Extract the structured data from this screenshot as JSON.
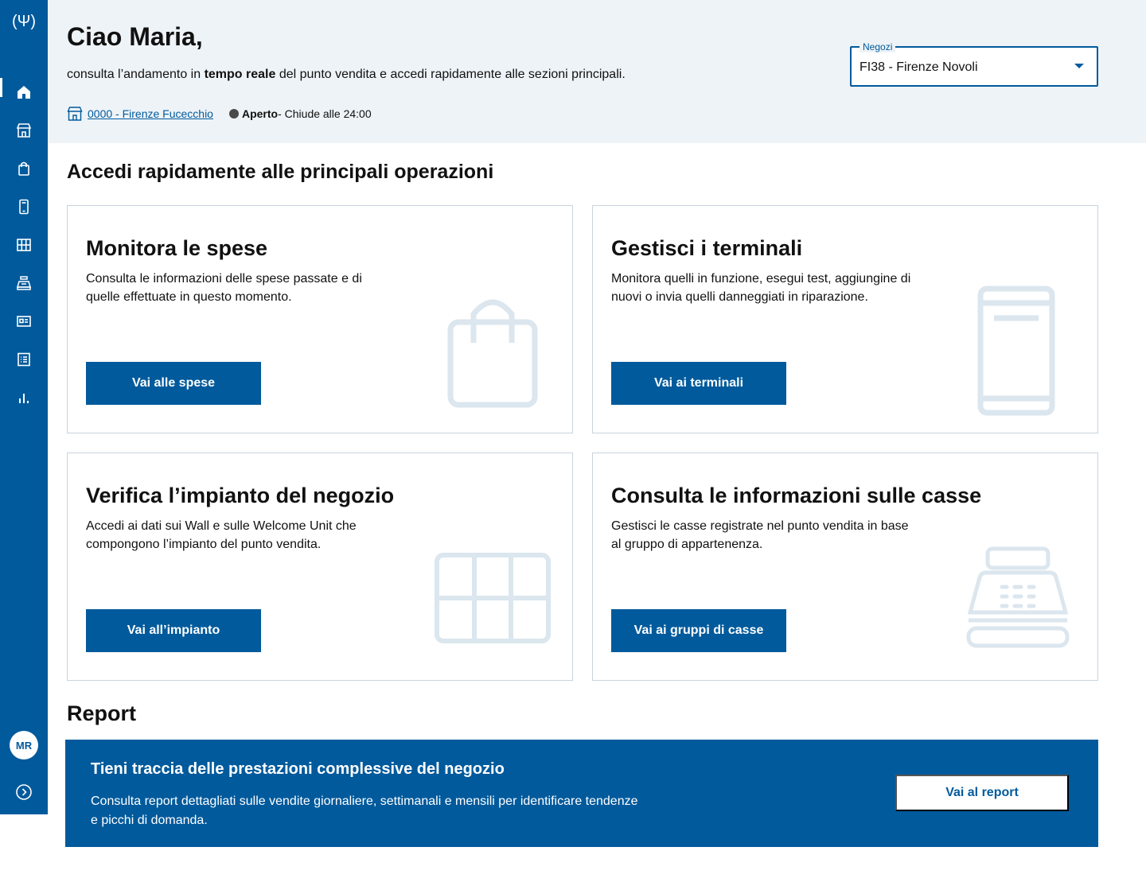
{
  "sidebar": {
    "logo": "(Ψ)",
    "items": [
      {
        "name": "home-icon",
        "label": "Home"
      },
      {
        "name": "store-icon",
        "label": "Negozio"
      },
      {
        "name": "bag-icon",
        "label": "Spese"
      },
      {
        "name": "phone-icon",
        "label": "Terminali"
      },
      {
        "name": "grid-icon",
        "label": "Impianto"
      },
      {
        "name": "cash-register-icon",
        "label": "Casse"
      },
      {
        "name": "id-card-icon",
        "label": "Anagrafica"
      },
      {
        "name": "list-icon",
        "label": "Elenco"
      },
      {
        "name": "bar-chart-icon",
        "label": "Report"
      }
    ],
    "avatar_initials": "MR"
  },
  "header": {
    "greeting": "Ciao Maria,",
    "subtitle_before": "consulta l’andamento in ",
    "subtitle_bold": "tempo reale",
    "subtitle_after": " del punto vendita e accedi rapidamente alle sezioni principali.",
    "store_link": "0000 - Firenze Fucecchio",
    "status_label": "Aperto",
    "status_detail": " - Chiude alle 24:00",
    "store_select": {
      "label": "Negozi",
      "value": "FI38 - Firenze Novoli"
    }
  },
  "quick_access": {
    "title": "Accedi rapidamente alle principali operazioni",
    "cards": [
      {
        "title": "Monitora le spese",
        "description": "Consulta le informazioni delle spese passate e di quelle effettuate in questo momento.",
        "button": "Vai alle spese"
      },
      {
        "title": "Gestisci i terminali",
        "description": "Monitora quelli in funzione, esegui test, aggiungine di nuovi o invia quelli danneggiati in riparazione.",
        "button": "Vai ai terminali"
      },
      {
        "title": "Verifica l’impianto del negozio",
        "description": "Accedi ai dati sui Wall e sulle Welcome Unit che compongono l’impianto del punto vendita.",
        "button": "Vai all’impianto"
      },
      {
        "title": "Consulta le informazioni sulle casse",
        "description": "Gestisci le casse registrate nel punto vendita in base al gruppo di appartenenza.",
        "button": "Vai ai gruppi di casse"
      }
    ]
  },
  "report": {
    "section_title": "Report",
    "banner_title": "Tieni traccia delle prestazioni complessive del negozio",
    "banner_text": "Consulta report dettagliati sulle vendite giornaliere, settimanali e mensili per identificare tendenze e picchi di domanda.",
    "button": "Vai al report"
  },
  "colors": {
    "primary": "#005a9c",
    "header_bg": "#eef3f7",
    "illustration": "#dbe6ee"
  }
}
